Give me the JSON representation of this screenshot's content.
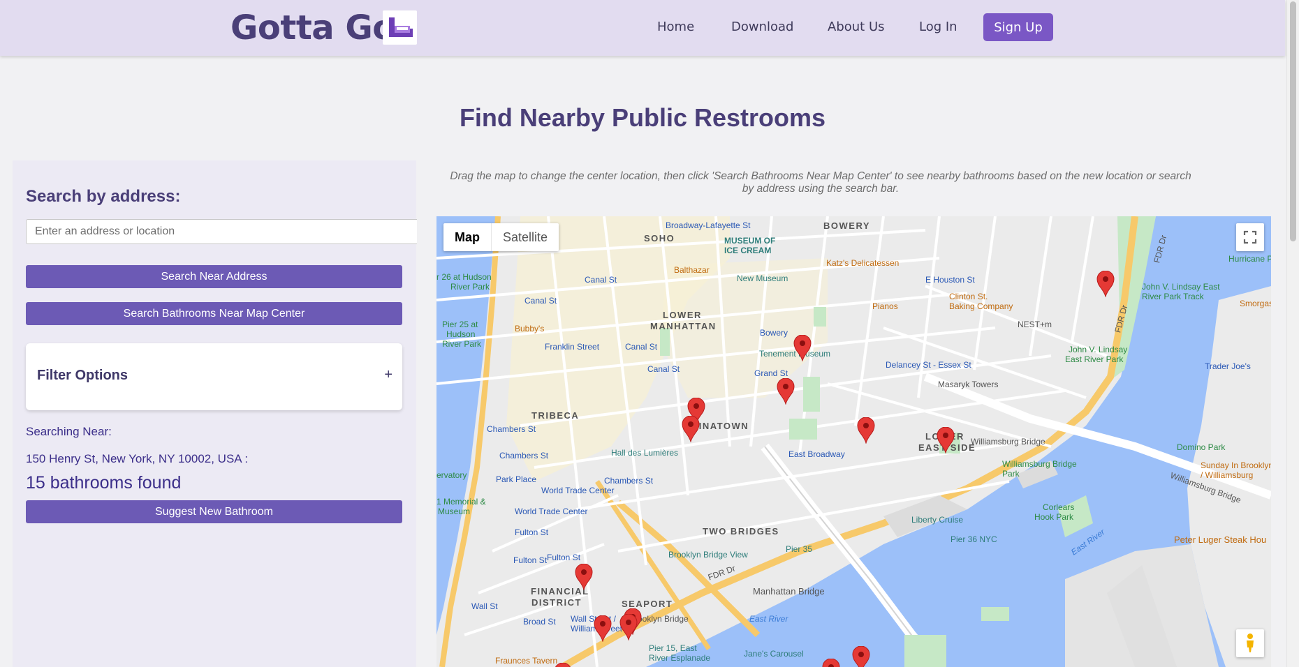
{
  "nav": {
    "brand": "Gotta Go!",
    "links": [
      "Home",
      "Download",
      "About Us",
      "Log In"
    ],
    "signup": "Sign Up"
  },
  "page": {
    "title": "Find Nearby Public Restrooms",
    "instructions": "Drag the map to change the center location, then click 'Search Bathrooms Near Map Center' to see nearby bathrooms based on the new location or search by address using the search bar."
  },
  "search": {
    "label": "Search by address:",
    "placeholder": "Enter an address or location",
    "near_address_btn": "Search Near Address",
    "map_center_btn": "Search Bathrooms Near Map Center"
  },
  "filter": {
    "title": "Filter Options",
    "toggle": "+"
  },
  "results": {
    "searching_near_label": "Searching Near:",
    "address": "150 Henry St, New York, NY 10002, USA :",
    "count_text": "15 bathrooms found",
    "suggest_btn": "Suggest New Bathroom"
  },
  "map": {
    "type_map": "Map",
    "type_satellite": "Satellite",
    "marker_color": "#e53935",
    "labels": {
      "soho": "SOHO",
      "bowery": "BOWERY",
      "lower_manhattan": "LOWER",
      "lower_manhattan2": "MANHATTAN",
      "tribeca": "TRIBECA",
      "chinatown": "CHINATOWN",
      "lower_east": "LOWER",
      "lower_east2": "EAST SIDE",
      "two_bridges": "TWO BRIDGES",
      "financial": "FINANCIAL",
      "financial2": "DISTRICT",
      "seaport": "SEAPORT",
      "museum_ice": "MUSEUM OF",
      "museum_ice2": "ICE CREAM",
      "broadway_lafayette": "Broadway-Lafayette St",
      "new_museum": "New Museum",
      "katz": "Katz's Delicatessen",
      "e_houston": "E Houston St",
      "clinton_st": "Clinton St.",
      "clinton_st2": "Baking Company",
      "balthazar": "Balthazar",
      "pianos": "Pianos",
      "tenement": "Tenement Museum",
      "bowery_st": "Bowery",
      "grand_st": "Grand St",
      "delancey": "Delancey St - Essex St",
      "masaryk": "Masaryk Towers",
      "nest": "NEST+m",
      "canal1": "Canal St",
      "canal2": "Canal St",
      "canal3": "Canal St",
      "canal4": "Canal St",
      "bubbys": "Bubby's",
      "franklin": "Franklin Street",
      "chambers1": "Chambers St",
      "chambers2": "Chambers St",
      "chambers3": "Chambers St",
      "hall_lumieres": "Hall des Lumières",
      "park_place": "Park Place",
      "wtc1": "World Trade Center",
      "wtc2": "World Trade Center",
      "east_broadway": "East Broadway",
      "fulton1": "Fulton St",
      "fulton2": "Fulton St",
      "fulton3": "Fulton St",
      "brooklyn_view": "Brooklyn Bridge View",
      "liberty": "Liberty Cruise",
      "pier36": "Pier 36 NYC",
      "pier35": "Pier 35",
      "manhattan_bridge": "Manhattan Bridge",
      "brooklyn_bridge": "Brooklyn Bridge",
      "east_river": "East River",
      "east_river2": "East River",
      "williamsburg": "Williamsburg Bridge",
      "williamsburg2": "Williamsburg Bridge",
      "williamsburg_park": "Williamsburg Bridge",
      "williamsburg_park2": "Park",
      "corlears": "Corlears",
      "corlears2": "Hook Park",
      "domino": "Domino Park",
      "sunday": "Sunday In Brooklyn",
      "sunday2": "/ Williamsburg",
      "peter_luger": "Peter Luger Steak Hou",
      "trader_joes": "Trader Joe's",
      "smorgasburg": "Smorgasbu",
      "hurricane": "Hurricane Poi",
      "lindsay1": "John V. Lindsay East",
      "lindsay2": "River Park Track",
      "lindsay3": "John V. Lindsay",
      "lindsay4": "East River Park",
      "pier25": "Pier 25 at",
      "pier25b": "Hudson",
      "pier25c": "River Park",
      "pier26": "r 26 at Hudson",
      "pier26b": "River Park",
      "wall_st": "Wall St",
      "wall_st2": "Wall Street /",
      "wall_st3": "William Street",
      "broad_st": "Broad St",
      "fraunces": "Fraunces Tavern",
      "janes": "Jane's Carousel",
      "pier15": "Pier 15, East",
      "pier15b": "River Esplanade",
      "memorial": "1 Memorial &",
      "memorial2": "Museum",
      "observatory": "ervatory",
      "fdr": "FDR Dr",
      "fdr2": "FDR Dr",
      "fdr3": "FDR Dr"
    }
  }
}
